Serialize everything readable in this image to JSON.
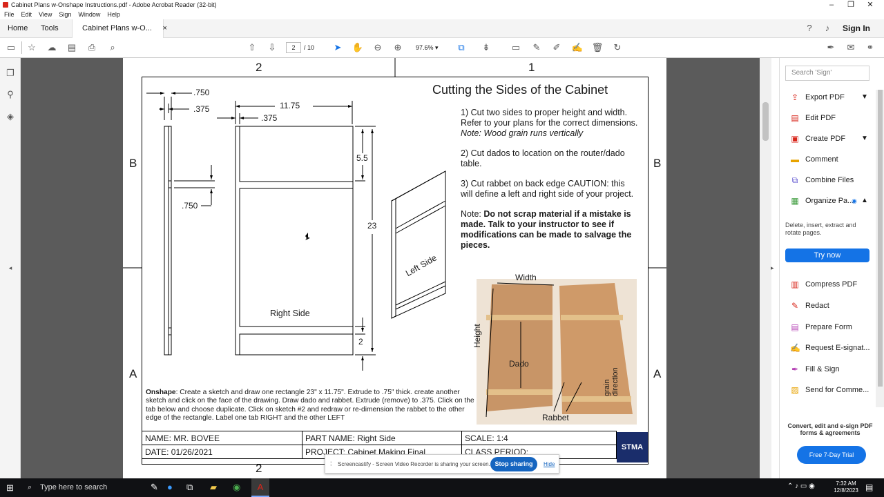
{
  "window": {
    "title": "Cabinet Plans w-Onshape Instructions.pdf - Adobe Acrobat Reader (32-bit)",
    "controls": [
      "–",
      "❐",
      "✕"
    ]
  },
  "menu": [
    "File",
    "Edit",
    "View",
    "Sign",
    "Window",
    "Help"
  ],
  "tabs": {
    "home": "Home",
    "tools": "Tools",
    "doc": "Cabinet Plans w-O...",
    "close": "×"
  },
  "signin": "Sign In",
  "toolbar": {
    "page_current": "2",
    "page_total": "/ 10",
    "zoom": "97.6%"
  },
  "page": {
    "grid_top_left": "2",
    "grid_top_right": "1",
    "grid_left_b": "B",
    "grid_right_b": "B",
    "grid_left_a": "A",
    "grid_right_a": "A",
    "grid_bottom": "2",
    "title": "Cutting the Sides of the Cabinet",
    "step1": "1)  Cut two sides to proper height and width. Refer to your plans for the correct dimensions.",
    "step1_note": "Note: Wood grain runs vertically",
    "step2": "2) Cut dados to location on the router/dado table.",
    "step3": "3) Cut rabbet on back edge CAUTION: this will define a left and right side of your project.",
    "note_label": "Note: ",
    "note_bold": "Do not scrap material if a mistake is made.  Talk to your instructor to see if modifications can be made to salvage the pieces.",
    "dims": {
      "d750": ".750",
      "d375": ".375",
      "d1175": "11.75",
      "d375b": ".375",
      "d55": "5.5",
      "d750b": ".750",
      "d23": "23",
      "d2": "2"
    },
    "right_side_label": "Right Side",
    "left_side_label": "Left Side",
    "photo_labels": {
      "width": "Width",
      "height": "Height",
      "dado": "Dado",
      "grain": "grain direction",
      "rabbet": "Rabbet"
    },
    "onshape_label": "Onshape",
    "onshape_text": ":  Create a sketch and draw one rectangle 23\" x 11.75\".  Extrude to .75\" thick. create another sketch and click on the face of the drawing.  Draw dado and rabbet.  Extrude (remove) to .375.  Click on the tab below and choose duplicate.  Click on sketch #2 and redraw or re-dimension the rabbet to the other edge of the rectangle.  Label one tab RIGHT and the other LEFT",
    "table": {
      "name": "NAME:  MR. BOVEE",
      "part": "PART NAME: Right Side",
      "scale": "SCALE: 1:4",
      "date": "DATE: 01/26/2021",
      "project": "PROJECT: Cabinet Making Final",
      "class": "CLASS PERIOD:"
    },
    "logo": "STMA"
  },
  "share_notice": {
    "text": "Screencastify - Screen Video Recorder is sharing your screen.",
    "stop": "Stop sharing",
    "hide": "Hide"
  },
  "right_panel": {
    "search_placeholder": "Search 'Sign'",
    "items": [
      {
        "label": "Export PDF",
        "color": "#d8261b"
      },
      {
        "label": "Edit PDF",
        "color": "#d8261b"
      },
      {
        "label": "Create PDF",
        "color": "#d8261b"
      },
      {
        "label": "Comment",
        "color": "#e8a300"
      },
      {
        "label": "Combine Files",
        "color": "#5a4fcf"
      },
      {
        "label": "Organize Pa...",
        "color": "#3a9a3a"
      },
      {
        "label": "Compress PDF",
        "color": "#d8261b"
      },
      {
        "label": "Redact",
        "color": "#d8261b"
      },
      {
        "label": "Prepare Form",
        "color": "#b33fb3"
      },
      {
        "label": "Request E-signat...",
        "color": "#b33fb3"
      },
      {
        "label": "Fill & Sign",
        "color": "#b33fb3"
      },
      {
        "label": "Send for Comme...",
        "color": "#e8a300"
      }
    ],
    "organize_desc": "Delete, insert, extract and rotate pages.",
    "try_now": "Try now",
    "footer": "Convert, edit and e-sign PDF forms & agreements",
    "trial": "Free 7-Day Trial"
  },
  "taskbar": {
    "search": "Type here to search",
    "time": "7:32 AM",
    "date": "12/8/2023"
  }
}
